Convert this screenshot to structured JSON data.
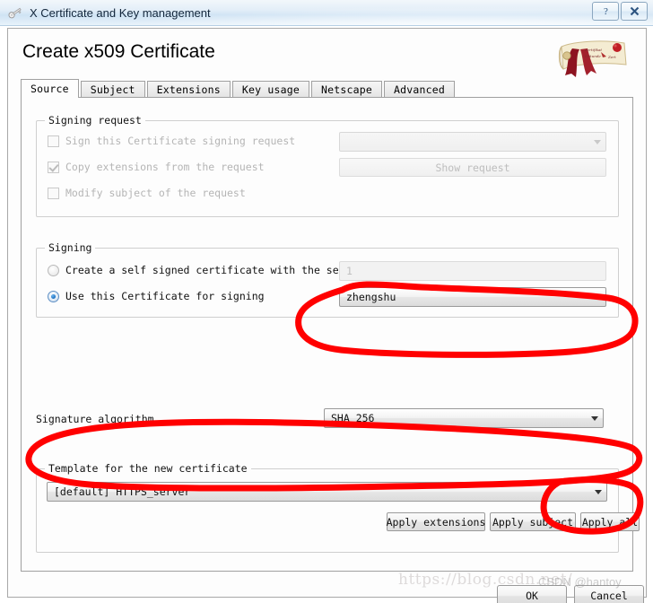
{
  "window": {
    "title": "X Certificate and Key management",
    "app_icon": "key-icon",
    "buttons": [
      {
        "name": "help-button",
        "label": "?"
      },
      {
        "name": "close-button",
        "label": "✕"
      }
    ]
  },
  "page": {
    "title": "Create x509 Certificate",
    "logo": "certificate-scroll-icon"
  },
  "tabs": [
    {
      "label": "Source",
      "active": true
    },
    {
      "label": "Subject",
      "active": false
    },
    {
      "label": "Extensions",
      "active": false
    },
    {
      "label": "Key usage",
      "active": false
    },
    {
      "label": "Netscape",
      "active": false
    },
    {
      "label": "Advanced",
      "active": false
    }
  ],
  "signing_request": {
    "legend": "Signing request",
    "checkbox_sign": {
      "label": "Sign this Certificate signing request",
      "checked": false,
      "enabled": false
    },
    "checkbox_copy_ext": {
      "label": "Copy extensions from the request",
      "checked": true,
      "enabled": false
    },
    "checkbox_modify_subject": {
      "label": "Modify subject of the request",
      "checked": false,
      "enabled": false
    },
    "request_combo": {
      "value": "",
      "enabled": false
    },
    "show_request_button": {
      "label": "Show request",
      "enabled": false
    }
  },
  "signing": {
    "legend": "Signing",
    "radio_self_signed": {
      "label": "Create a self signed certificate with the serial",
      "selected": false
    },
    "serial_field": {
      "value": "1",
      "enabled": false
    },
    "radio_use_cert": {
      "label": "Use this Certificate for signing",
      "selected": true
    },
    "signer_combo": {
      "value": "zhengshu",
      "enabled": true
    }
  },
  "signature_algorithm": {
    "label": "Signature algorithm",
    "value": "SHA 256"
  },
  "template": {
    "legend": "Template for the new certificate",
    "combo_value": "[default] HTTPS_server",
    "apply_extensions_label": "Apply extensions",
    "apply_subject_label": "Apply subject",
    "apply_all_label": "Apply all"
  },
  "footer": {
    "ok_label": "OK",
    "cancel_label": "Cancel"
  },
  "watermark": {
    "url": "https://blog.csdn.net/",
    "credit": "CSDN @hantoy"
  },
  "annotations": {
    "color": "#ff0000",
    "shapes": [
      "ellipse-around-signer-combo",
      "ellipse-around-template-group",
      "ellipse-around-apply-all-button"
    ]
  }
}
